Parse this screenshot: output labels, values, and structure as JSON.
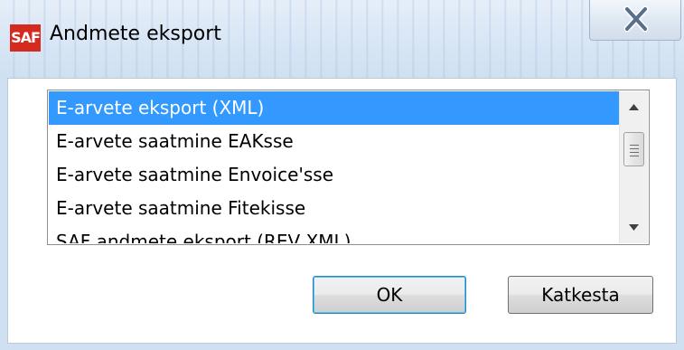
{
  "window": {
    "logo_text": "SAF",
    "title": "Andmete eksport"
  },
  "export_list": {
    "items": [
      {
        "label": "E-arvete eksport (XML)",
        "selected": true
      },
      {
        "label": "E-arvete saatmine EAKsse",
        "selected": false
      },
      {
        "label": "E-arvete saatmine Envoice'sse",
        "selected": false
      },
      {
        "label": "E-arvete saatmine Fitekisse",
        "selected": false
      },
      {
        "label": "SAF andmete eksport (REV XML)",
        "selected": false
      }
    ]
  },
  "buttons": {
    "ok_label": "OK",
    "cancel_label": "Katkesta"
  },
  "colors": {
    "selection": "#3399ff",
    "logo": "#d42a1f"
  }
}
